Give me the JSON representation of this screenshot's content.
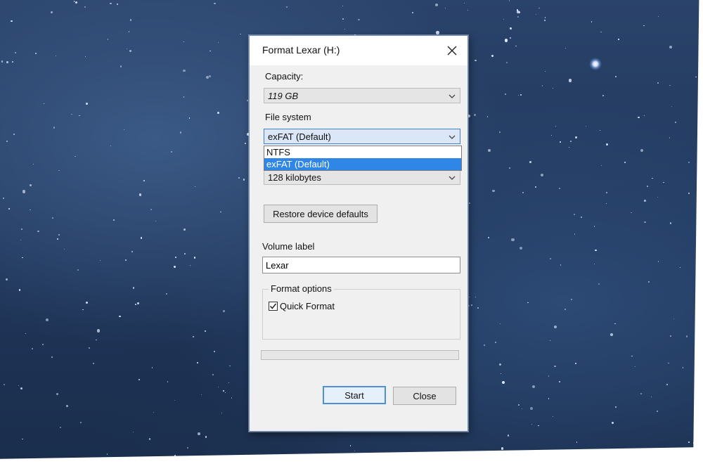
{
  "dialog": {
    "title": "Format Lexar (H:)",
    "close_icon": "close-icon",
    "capacity": {
      "label": "Capacity:",
      "value": "119 GB"
    },
    "file_system": {
      "label": "File system",
      "value": "exFAT (Default)",
      "options": [
        "NTFS",
        "exFAT (Default)"
      ],
      "selected_index": 1
    },
    "allocation_unit": {
      "value": "128 kilobytes"
    },
    "restore_button": "Restore device defaults",
    "volume_label": {
      "label": "Volume label",
      "value": "Lexar"
    },
    "format_options": {
      "legend": "Format options",
      "quick_format_label": "Quick Format",
      "quick_format_checked": true
    },
    "progress_fraction": 0,
    "buttons": {
      "start": "Start",
      "close": "Close"
    }
  },
  "colors": {
    "accent": "#2f86e6",
    "dialog_bg": "#f0f0f0",
    "focus_border": "#3c7fd6",
    "progress_fill": "#06b025"
  }
}
